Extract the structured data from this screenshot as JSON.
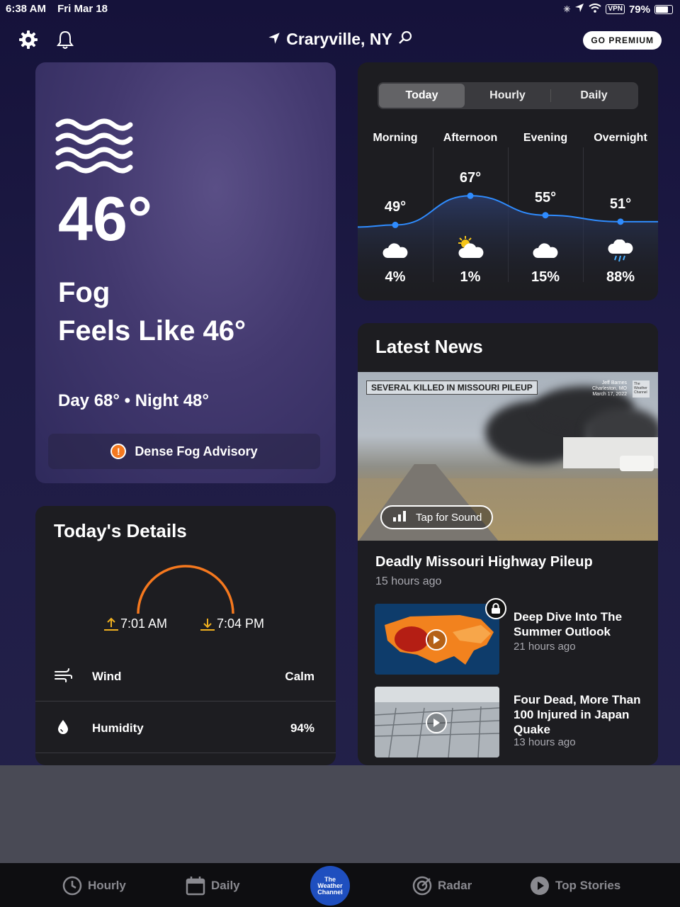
{
  "status_bar": {
    "time": "6:38 AM",
    "date": "Fri Mar 18",
    "vpn": "VPN",
    "battery": "79%",
    "battery_level": 0.79
  },
  "header": {
    "location": "Craryville, NY",
    "premium_label": "GO PREMIUM"
  },
  "current": {
    "icon": "fog-icon",
    "temperature": "46°",
    "condition": "Fog",
    "feels_like": "Feels Like 46°",
    "day_night": "Day 68° • Night 48°",
    "advisory": "Dense Fog Advisory"
  },
  "forecast": {
    "tabs": [
      "Today",
      "Hourly",
      "Daily"
    ],
    "active_tab": "Today",
    "periods": [
      {
        "name": "Morning",
        "temp": "49°",
        "temp_value": 49,
        "icon": "cloud-icon",
        "precip": "4%"
      },
      {
        "name": "Afternoon",
        "temp": "67°",
        "temp_value": 67,
        "icon": "partly-sunny-icon",
        "precip": "1%"
      },
      {
        "name": "Evening",
        "temp": "55°",
        "temp_value": 55,
        "icon": "cloud-icon",
        "precip": "15%"
      },
      {
        "name": "Overnight",
        "temp": "51°",
        "temp_value": 51,
        "icon": "rain-cloud-icon",
        "precip": "88%"
      }
    ]
  },
  "details": {
    "title": "Today's Details",
    "sunrise": "7:01 AM",
    "sunset": "7:04 PM",
    "rows": [
      {
        "icon": "wind-icon",
        "label": "Wind",
        "value": "Calm"
      },
      {
        "icon": "humidity-drop-icon",
        "label": "Humidity",
        "value": "94%"
      }
    ]
  },
  "news": {
    "title": "Latest News",
    "hero": {
      "banner": "SEVERAL KILLED IN MISSOURI PILEUP",
      "credit": [
        "Jeff Barnes",
        "Charleston, MO",
        "March 17, 2022"
      ],
      "tap_sound": "Tap for Sound",
      "headline": "Deadly Missouri Highway Pileup",
      "time": "15 hours ago"
    },
    "stories": [
      {
        "title": "Deep Dive Into The Summer Outlook",
        "time": "21 hours ago",
        "locked": true
      },
      {
        "title": "Four Dead, More Than 100 Injured in Japan Quake",
        "time": "13 hours ago",
        "locked": false
      }
    ]
  },
  "tab_bar": {
    "items": [
      "Hourly",
      "Daily",
      "Radar",
      "Top Stories"
    ],
    "logo_lines": [
      "The",
      "Weather",
      "Channel"
    ]
  },
  "colors": {
    "accent_orange": "#f5781e",
    "curve_blue": "#2f8cff",
    "card_bg": "#1d1d21"
  }
}
